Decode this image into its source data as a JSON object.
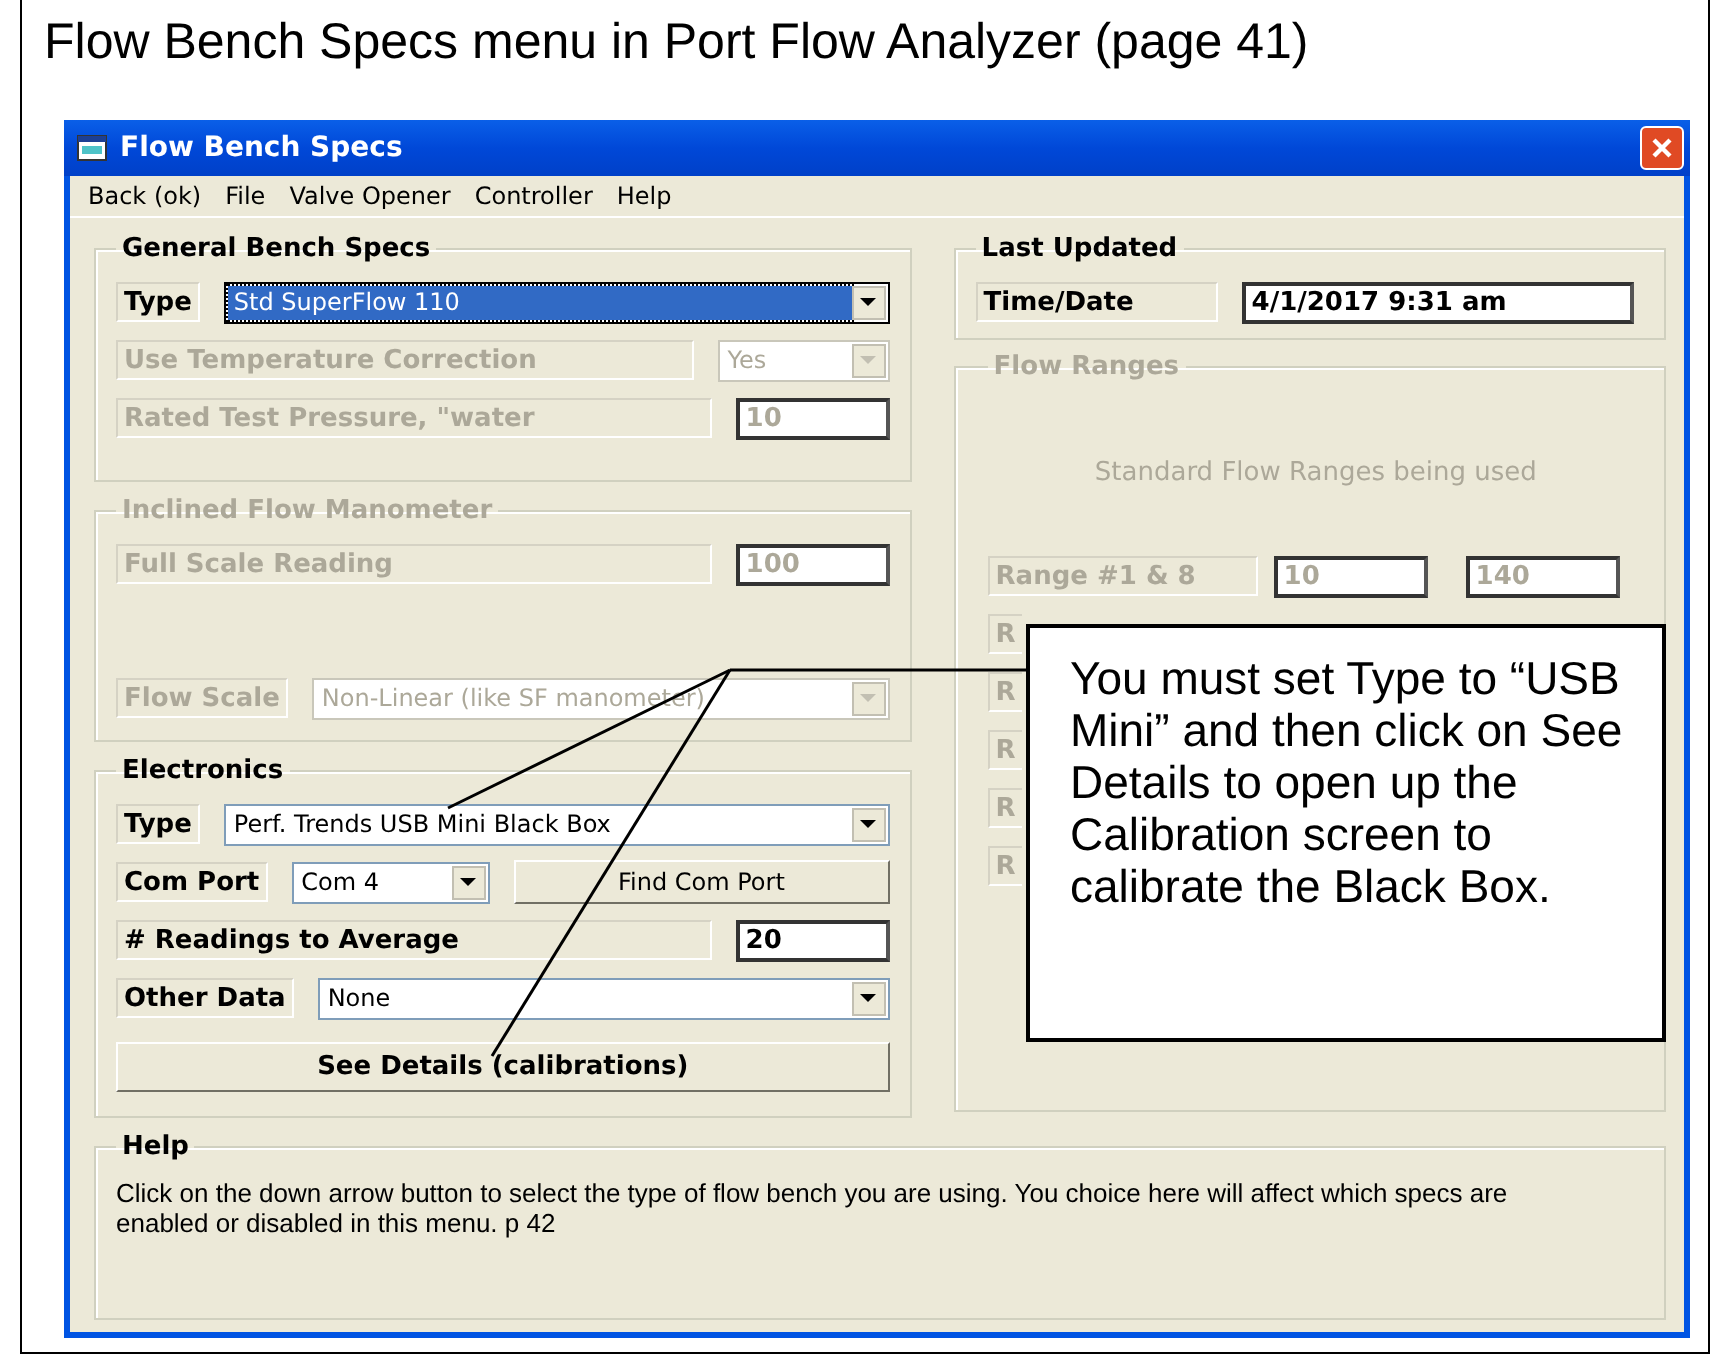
{
  "caption": "Flow Bench Specs menu in Port Flow Analyzer (page 41)",
  "window": {
    "title": "Flow Bench Specs"
  },
  "menu": [
    "Back (ok)",
    "File",
    "Valve Opener",
    "Controller",
    "Help"
  ],
  "general": {
    "title": "General Bench Specs",
    "disabled": false,
    "rows": [
      {
        "kind": "combo",
        "label": "Type",
        "value": "Std SuperFlow 110",
        "disabled": false,
        "focused": true
      },
      {
        "kind": "combo-short",
        "label": "Use Temperature Correction",
        "value": "Yes",
        "disabled": true,
        "focused": false
      },
      {
        "kind": "input",
        "label": "Rated Test Pressure, \"water",
        "value": "10",
        "disabled": true,
        "focused": false
      }
    ]
  },
  "manometer": {
    "title": "Inclined Flow Manometer",
    "disabled": true,
    "rows": [
      {
        "kind": "input",
        "label": "Full Scale Reading",
        "value": "100",
        "disabled": true,
        "focused": false
      },
      {
        "kind": "combo",
        "label": "Flow Scale",
        "value": "Non-Linear (like SF manometer)",
        "disabled": true,
        "focused": false
      }
    ]
  },
  "electronics": {
    "title": "Electronics",
    "disabled": false,
    "rows": [
      {
        "kind": "combo",
        "label": "Type",
        "value": "Perf. Trends USB Mini Black Box",
        "disabled": false,
        "focused": false
      },
      {
        "kind": "combo-button",
        "label": "Com Port",
        "value": "Com 4",
        "button": "Find Com Port",
        "disabled": false,
        "focused": false
      },
      {
        "kind": "input",
        "label": "# Readings to Average",
        "value": "20",
        "disabled": false,
        "focused": false
      },
      {
        "kind": "combo",
        "label": "Other Data",
        "value": "None",
        "disabled": false,
        "focused": false
      }
    ],
    "button": "See Details (calibrations)"
  },
  "last_updated": {
    "title": "Last Updated",
    "label": "Time/Date",
    "value": "4/1/2017  9:31 am"
  },
  "flow_ranges": {
    "title": "Flow Ranges",
    "disabled": true,
    "note": "Standard Flow Ranges being used",
    "rows": [
      {
        "label": "Range #1 & 8",
        "low": "10",
        "high": "140"
      },
      {
        "label": "R"
      },
      {
        "label": "R"
      },
      {
        "label": "R"
      },
      {
        "label": "R"
      },
      {
        "label": "R"
      }
    ]
  },
  "help": {
    "title": "Help",
    "text": "Click on the down arrow button to select the type of flow bench you are using.  You choice here will affect which specs are enabled or disabled in this menu.  p 42"
  },
  "callout": {
    "text": "You must set Type to “USB Mini” and then click on See Details to open up the Calibration screen to calibrate the Black Box."
  }
}
